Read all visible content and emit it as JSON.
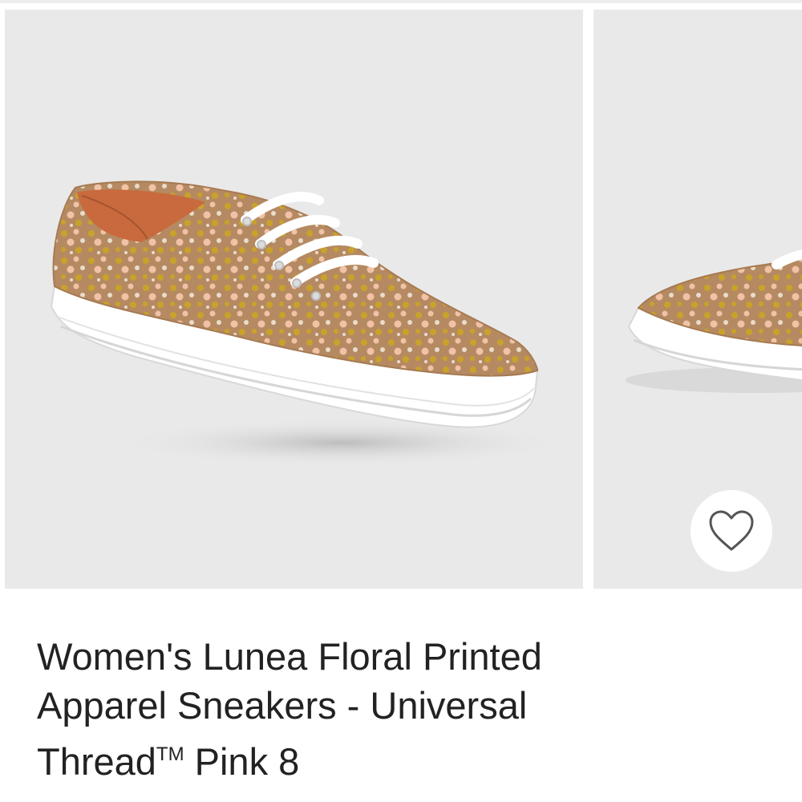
{
  "product": {
    "title_line1": "Women's Lunea Floral Printed",
    "title_line2": "Apparel Sneakers - Universal",
    "title_line3_brand": "Thread",
    "title_line3_mark": "TM",
    "title_line3_rest": " Pink 8"
  },
  "gallery": {
    "images": [
      {
        "alt": "Floral printed sneaker, side view"
      },
      {
        "alt": "Floral printed sneaker, alternate view"
      }
    ]
  },
  "favorite": {
    "icon": "heart-outline-icon",
    "aria_label": "Add to favorites"
  },
  "colors": {
    "background": "#ffffff",
    "image_bg": "#e9e9e9",
    "shoe_base": "#b58a62",
    "floral_yellow": "#c9a22a",
    "floral_pink": "#f1c2a6",
    "sole": "#ffffff",
    "text": "#222222"
  }
}
